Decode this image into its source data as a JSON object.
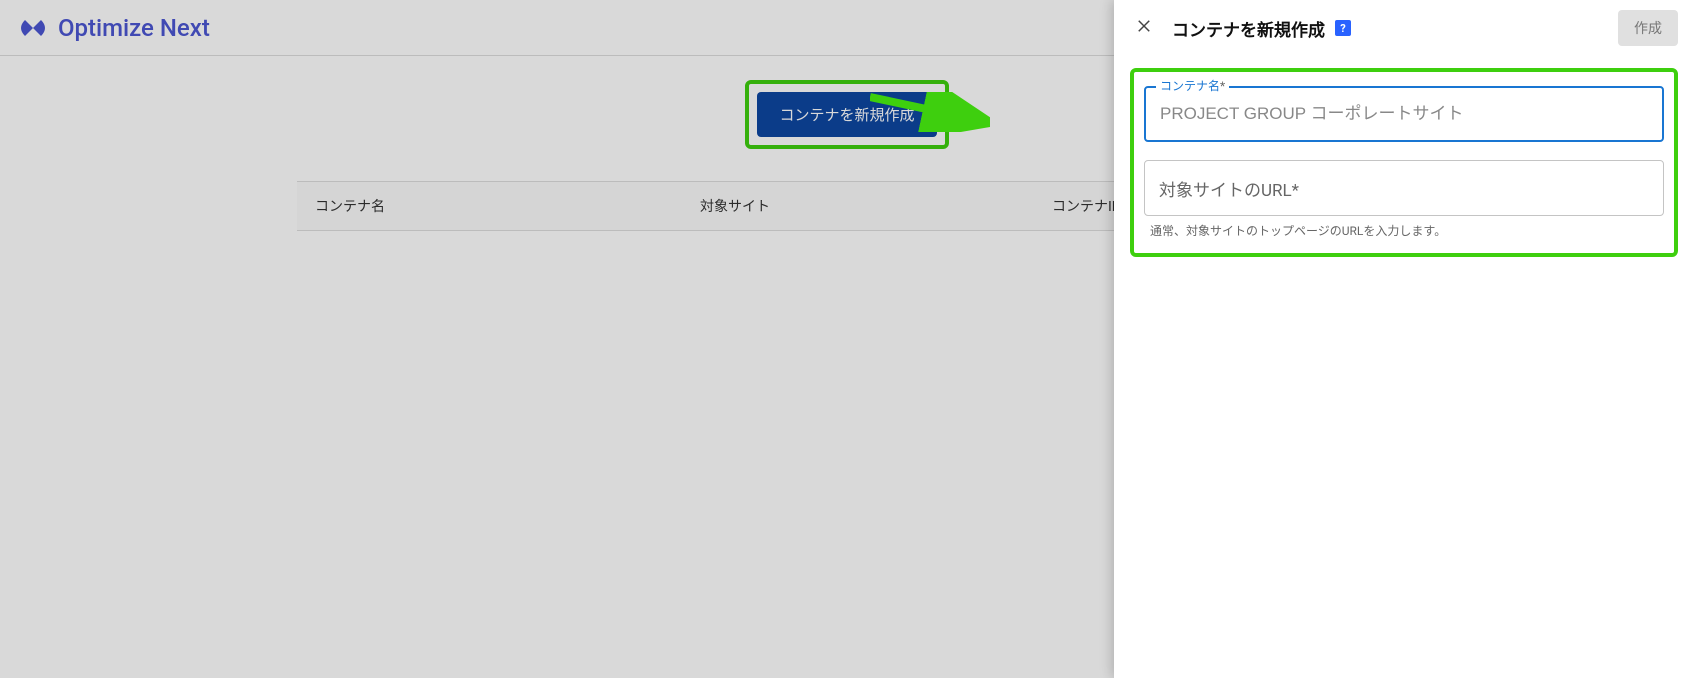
{
  "header": {
    "brand": "Optimize Next"
  },
  "main": {
    "new_button_label": "コンテナを新規作成",
    "table": {
      "columns": [
        "コンテナ名",
        "対象サイト",
        "コンテナID"
      ]
    }
  },
  "panel": {
    "title": "コンテナを新規作成",
    "help_glyph": "?",
    "create_label": "作成",
    "fields": {
      "name": {
        "label": "コンテナ名",
        "required_mark": "*",
        "placeholder": "PROJECT GROUP コーポレートサイト",
        "value": ""
      },
      "url": {
        "label": "対象サイトのURL",
        "required_mark": "*",
        "value": "",
        "helper": "通常、対象サイトのトップページのURLを入力します。"
      }
    }
  },
  "annotations": {
    "highlight_color": "#3ecf0e"
  }
}
